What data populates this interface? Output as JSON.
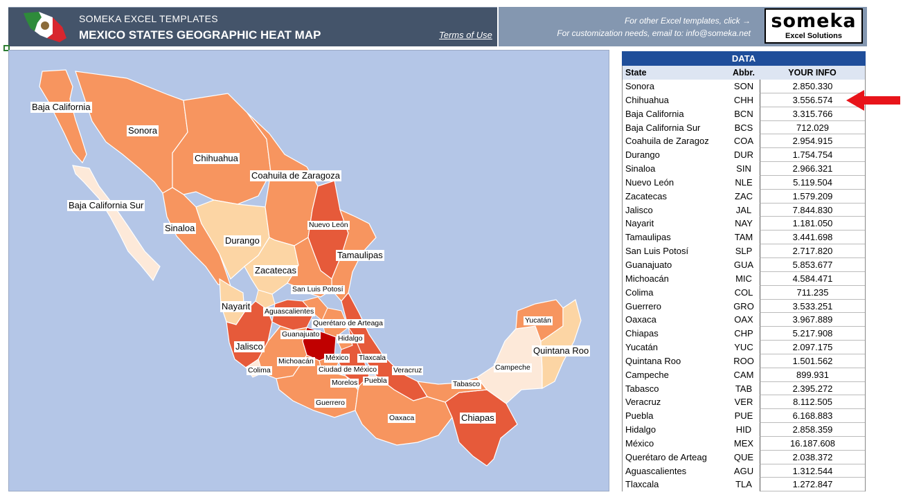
{
  "header": {
    "brand_small": "SOMEKA EXCEL TEMPLATES",
    "title": "MEXICO STATES GEOGRAPHIC HEAT MAP",
    "terms": "Terms of Use",
    "other_templates": "For other Excel templates, click →",
    "customization": "For customization needs, email to: info@someka.net",
    "logo_main": "someka",
    "logo_sub": "Excel Solutions"
  },
  "colors": {
    "header_dark": "#44546a",
    "header_light": "#8497b0",
    "map_bg": "#b4c6e7",
    "table_head": "#1f4e9a",
    "heat_lowest": "#fde9d9",
    "heat_low": "#fcd5a4",
    "heat_mid": "#f7955f",
    "heat_high": "#e65a3a",
    "heat_highest": "#c00000",
    "arrow": "#e8141a"
  },
  "map_labels": {
    "baja_california": "Baja California",
    "sonora": "Sonora",
    "chihuahua": "Chihuahua",
    "coahuila": "Coahuila de Zaragoza",
    "baja_california_sur": "Baja California Sur",
    "sinaloa": "Sinaloa",
    "durango": "Durango",
    "nuevo_leon": "Nuevo León",
    "tamaulipas": "Tamaulipas",
    "zacatecas": "Zacatecas",
    "san_luis_potosi": "San Luis Potosí",
    "nayarit": "Nayarit",
    "aguascalientes": "Aguascalientes",
    "queretaro": "Querétaro de Arteaga",
    "guanajuato": "Guanajuato",
    "hidalgo": "Hidalgo",
    "jalisco": "Jalisco",
    "mexico": "México",
    "tlaxcala": "Tlaxcala",
    "michoacan": "Michoacán",
    "ciudad_de_mexico": "Ciudad de México",
    "veracruz": "Veracruz",
    "colima": "Colima",
    "morelos": "Morelos",
    "puebla": "Puebla",
    "guerrero": "Guerrero",
    "oaxaca": "Oaxaca",
    "chiapas": "Chiapas",
    "tabasco": "Tabasco",
    "campeche": "Campeche",
    "yucatan": "Yucatán",
    "quintana_roo": "Quintana Roo"
  },
  "table": {
    "title": "DATA",
    "col_state": "State",
    "col_abbr": "Abbr.",
    "col_info": "YOUR INFO",
    "rows": [
      {
        "state": "Sonora",
        "abbr": "SON",
        "info": "2.850.330"
      },
      {
        "state": "Chihuahua",
        "abbr": "CHH",
        "info": "3.556.574"
      },
      {
        "state": "Baja California",
        "abbr": "BCN",
        "info": "3.315.766"
      },
      {
        "state": "Baja California Sur",
        "abbr": "BCS",
        "info": "712.029"
      },
      {
        "state": "Coahuila de Zaragoz",
        "abbr": "COA",
        "info": "2.954.915"
      },
      {
        "state": "Durango",
        "abbr": "DUR",
        "info": "1.754.754"
      },
      {
        "state": "Sinaloa",
        "abbr": "SIN",
        "info": "2.966.321"
      },
      {
        "state": "Nuevo León",
        "abbr": "NLE",
        "info": "5.119.504"
      },
      {
        "state": "Zacatecas",
        "abbr": "ZAC",
        "info": "1.579.209"
      },
      {
        "state": "Jalisco",
        "abbr": "JAL",
        "info": "7.844.830"
      },
      {
        "state": "Nayarit",
        "abbr": "NAY",
        "info": "1.181.050"
      },
      {
        "state": "Tamaulipas",
        "abbr": "TAM",
        "info": "3.441.698"
      },
      {
        "state": "San Luis Potosí",
        "abbr": "SLP",
        "info": "2.717.820"
      },
      {
        "state": "Guanajuato",
        "abbr": "GUA",
        "info": "5.853.677"
      },
      {
        "state": "Michoacán",
        "abbr": "MIC",
        "info": "4.584.471"
      },
      {
        "state": "Colima",
        "abbr": "COL",
        "info": "711.235"
      },
      {
        "state": "Guerrero",
        "abbr": "GRO",
        "info": "3.533.251"
      },
      {
        "state": "Oaxaca",
        "abbr": "OAX",
        "info": "3.967.889"
      },
      {
        "state": "Chiapas",
        "abbr": "CHP",
        "info": "5.217.908"
      },
      {
        "state": "Yucatán",
        "abbr": "YUC",
        "info": "2.097.175"
      },
      {
        "state": "Quintana Roo",
        "abbr": "ROO",
        "info": "1.501.562"
      },
      {
        "state": "Campeche",
        "abbr": "CAM",
        "info": "899.931"
      },
      {
        "state": "Tabasco",
        "abbr": "TAB",
        "info": "2.395.272"
      },
      {
        "state": "Veracruz",
        "abbr": "VER",
        "info": "8.112.505"
      },
      {
        "state": "Puebla",
        "abbr": "PUE",
        "info": "6.168.883"
      },
      {
        "state": "Hidalgo",
        "abbr": "HID",
        "info": "2.858.359"
      },
      {
        "state": "México",
        "abbr": "MEX",
        "info": "16.187.608"
      },
      {
        "state": "Querétaro de Arteag",
        "abbr": "QUE",
        "info": "2.038.372"
      },
      {
        "state": "Aguascalientes",
        "abbr": "AGU",
        "info": "1.312.544"
      },
      {
        "state": "Tlaxcala",
        "abbr": "TLA",
        "info": "1.272.847"
      }
    ]
  }
}
